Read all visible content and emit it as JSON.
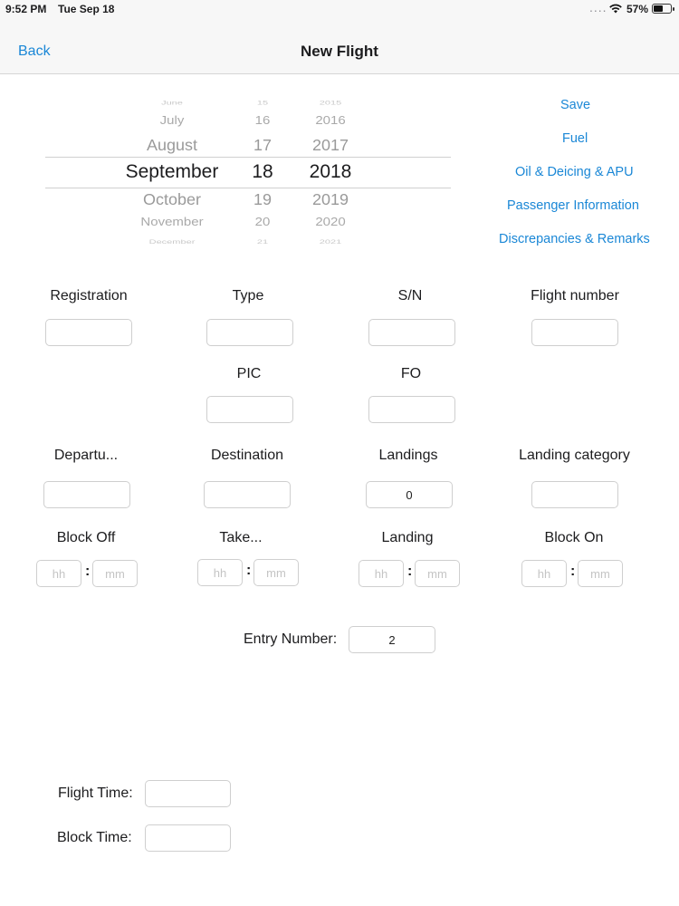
{
  "status_bar": {
    "time": "9:52 PM",
    "date": "Tue Sep 18",
    "battery_percent": "57%",
    "battery_level": 0.57,
    "signal_dots": "....",
    "icons": [
      "wifi-icon",
      "battery-icon"
    ]
  },
  "nav": {
    "back_label": "Back",
    "title": "New Flight"
  },
  "date_picker": {
    "rows": [
      {
        "month": "June",
        "day": "15",
        "year": "2015"
      },
      {
        "month": "July",
        "day": "16",
        "year": "2016"
      },
      {
        "month": "August",
        "day": "17",
        "year": "2017"
      },
      {
        "month": "September",
        "day": "18",
        "year": "2018"
      },
      {
        "month": "October",
        "day": "19",
        "year": "2019"
      },
      {
        "month": "November",
        "day": "20",
        "year": "2020"
      },
      {
        "month": "December",
        "day": "21",
        "year": "2021"
      }
    ],
    "selected": {
      "month": "September",
      "day": "18",
      "year": "2018"
    }
  },
  "side_actions": {
    "save": "Save",
    "fuel": "Fuel",
    "oil_deicing_apu": "Oil & Deicing & APU",
    "passenger_information": "Passenger Information",
    "discrepancies_remarks": "Discrepancies & Remarks"
  },
  "fields": {
    "registration": {
      "label": "Registration",
      "value": ""
    },
    "type": {
      "label": "Type",
      "value": ""
    },
    "sn": {
      "label": "S/N",
      "value": ""
    },
    "flight_number": {
      "label": "Flight number",
      "value": ""
    },
    "pic": {
      "label": "PIC",
      "value": ""
    },
    "fo": {
      "label": "FO",
      "value": ""
    },
    "departure": {
      "label": "Departu...",
      "value": ""
    },
    "destination": {
      "label": "Destination",
      "value": ""
    },
    "landings": {
      "label": "Landings",
      "value": "0"
    },
    "landing_category": {
      "label": "Landing category",
      "value": ""
    }
  },
  "times": {
    "block_off": {
      "label": "Block Off"
    },
    "takeoff": {
      "label": "Take..."
    },
    "landing": {
      "label": "Landing"
    },
    "block_on": {
      "label": "Block On"
    },
    "hh_placeholder": "hh",
    "mm_placeholder": "mm",
    "separator": ":"
  },
  "entry_number": {
    "label": "Entry Number:",
    "value": "2"
  },
  "totals": {
    "flight_time": {
      "label": "Flight Time:",
      "value": ""
    },
    "block_time": {
      "label": "Block Time:",
      "value": ""
    }
  }
}
